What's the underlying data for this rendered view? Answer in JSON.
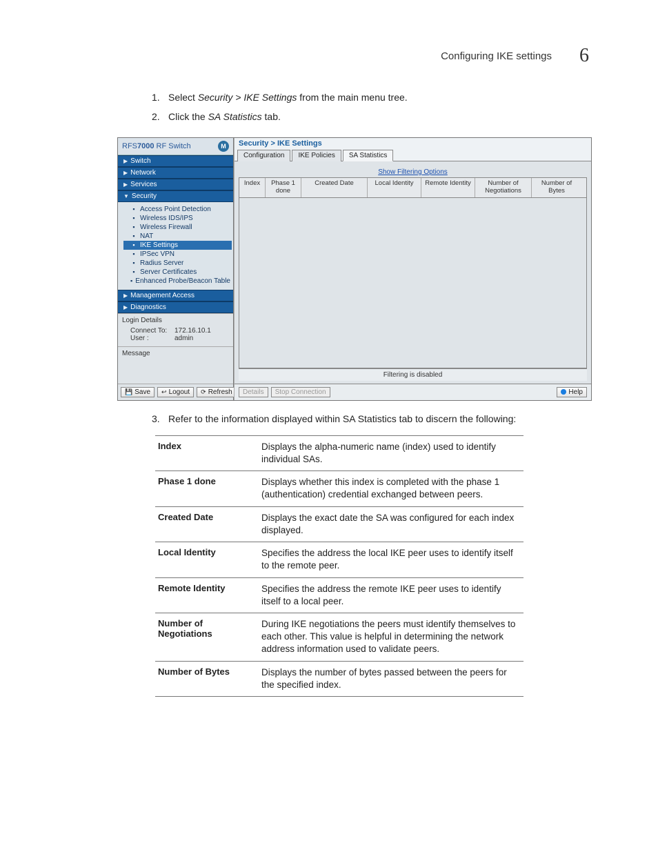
{
  "header": {
    "title": "Configuring IKE settings",
    "chapter": "6"
  },
  "steps": {
    "s1_pre": "Select ",
    "s1_em": "Security > IKE Settings",
    "s1_post": " from the main menu tree.",
    "s2_pre": "Click the ",
    "s2_em": "SA Statistics",
    "s2_post": " tab.",
    "s3": "Refer to the information displayed within SA Statistics tab to discern the following:"
  },
  "app": {
    "brand_prefix": "RFS",
    "brand_bold": "7000",
    "brand_suffix": " RF Switch",
    "brand_glyph": "M",
    "nav": {
      "switch": "Switch",
      "network": "Network",
      "services": "Services",
      "security": "Security",
      "mgmt": "Management Access",
      "diag": "Diagnostics"
    },
    "tree": {
      "apd": "Access Point Detection",
      "ids": "Wireless IDS/IPS",
      "fw": "Wireless Firewall",
      "nat": "NAT",
      "ike": "IKE Settings",
      "ipsec": "IPSec VPN",
      "radius": "Radius Server",
      "certs": "Server Certificates",
      "probe": "Enhanced Probe/Beacon Table"
    },
    "login": {
      "title": "Login Details",
      "connect_k": "Connect To:",
      "connect_v": "172.16.10.1",
      "user_k": "User :",
      "user_v": "admin"
    },
    "message_title": "Message",
    "side_btns": {
      "save": "Save",
      "logout": "Logout",
      "refresh": "Refresh"
    },
    "crumb": "Security > IKE Settings",
    "tabs": {
      "config": "Configuration",
      "policies": "IKE Policies",
      "sa": "SA Statistics"
    },
    "filter_link": "Show Filtering Options",
    "cols": {
      "index": "Index",
      "phase": "Phase 1 done",
      "created": "Created Date",
      "local": "Local Identity",
      "remote": "Remote Identity",
      "neg": "Number of Negotiations",
      "bytes": "Number of Bytes"
    },
    "status": "Filtering is disabled",
    "btns": {
      "details": "Details",
      "stop": "Stop Connection",
      "help": "Help"
    }
  },
  "defs": [
    {
      "k": "Index",
      "v": "Displays the alpha-numeric name (index) used to identify individual SAs."
    },
    {
      "k": "Phase 1 done",
      "v": "Displays whether this index is completed with the phase 1 (authentication) credential exchanged between peers."
    },
    {
      "k": "Created Date",
      "v": "Displays the exact date the SA was configured for each index displayed."
    },
    {
      "k": "Local Identity",
      "v": "Specifies the address the local IKE peer uses to identify itself to the remote peer."
    },
    {
      "k": "Remote Identity",
      "v": "Specifies the address the remote IKE peer uses to identify itself to a local peer."
    },
    {
      "k": "Number of Negotiations",
      "v": "During IKE negotiations the peers must identify themselves to each other. This value is helpful in determining the network address information used to validate peers."
    },
    {
      "k": "Number of Bytes",
      "v": "Displays the number of bytes passed between the peers for the specified index."
    }
  ]
}
